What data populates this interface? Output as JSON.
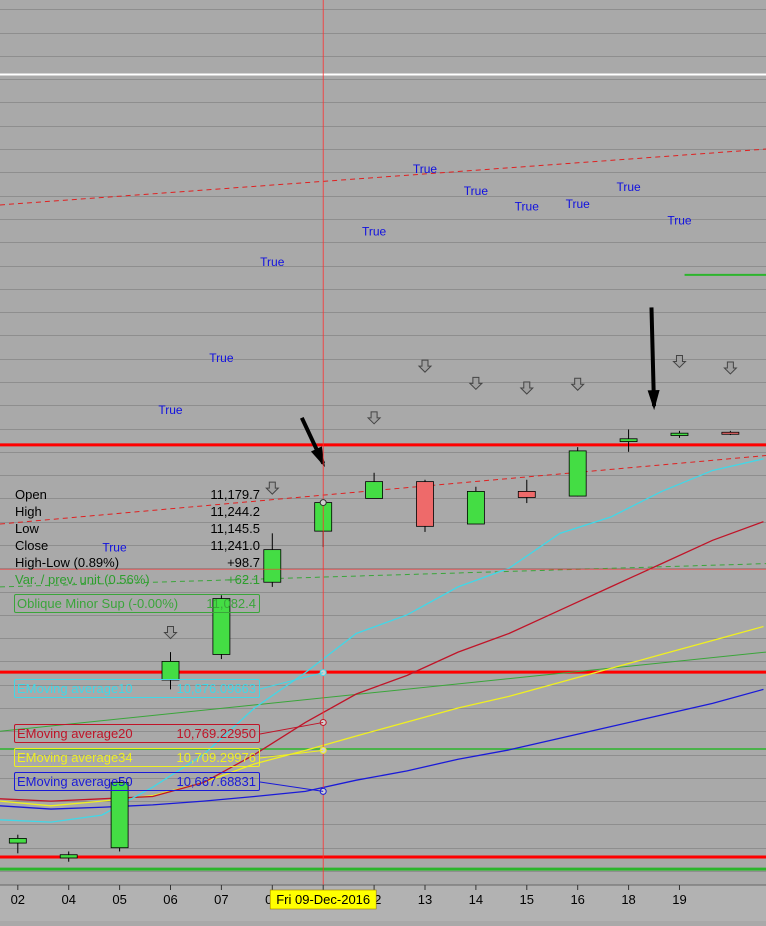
{
  "chart_data": {
    "type": "candlestick",
    "x_labels": [
      "02",
      "04",
      "05",
      "06",
      "07",
      "08",
      "09",
      "12",
      "13",
      "14",
      "15",
      "16",
      "18",
      "19"
    ],
    "cursor_date": "Fri 09-Dec-2016",
    "candles": [
      {
        "date": "02",
        "open": 10510,
        "high": 10528,
        "low": 10488,
        "close": 10520
      },
      {
        "date": "04",
        "open": 10478,
        "high": 10492,
        "low": 10470,
        "close": 10485
      },
      {
        "date": "05",
        "open": 10500,
        "high": 10650,
        "low": 10492,
        "close": 10640
      },
      {
        "date": "06",
        "open": 10860,
        "high": 10920,
        "low": 10840,
        "close": 10900
      },
      {
        "date": "07",
        "open": 10915,
        "high": 11042,
        "low": 10905,
        "close": 11035
      },
      {
        "date": "08",
        "open": 11070,
        "high": 11175,
        "low": 11060,
        "close": 11140
      },
      {
        "date": "09",
        "open": 11179.7,
        "high": 11244.2,
        "low": 11145.5,
        "close": 11241.0
      },
      {
        "date": "12",
        "open": 11250,
        "high": 11305,
        "low": 11250,
        "close": 11286
      },
      {
        "date": "13",
        "open": 11286,
        "high": 11290,
        "low": 11178,
        "close": 11190
      },
      {
        "date": "14",
        "open": 11195,
        "high": 11275,
        "low": 11195,
        "close": 11265
      },
      {
        "date": "15",
        "open": 11265,
        "high": 11290,
        "low": 11240,
        "close": 11252
      },
      {
        "date": "16",
        "open": 11255,
        "high": 11360,
        "low": 11254,
        "close": 11352
      },
      {
        "date": "18",
        "open": 11372,
        "high": 11398,
        "low": 11350,
        "close": 11378
      },
      {
        "date": "19",
        "open": 11385,
        "high": 11395,
        "low": 11380,
        "close": 11390
      },
      {
        "date": "20",
        "open": 11392,
        "high": 11395,
        "low": 11386,
        "close": 11389
      }
    ],
    "ema10": [
      10560,
      10555,
      10570,
      10630,
      10700,
      10800,
      10876,
      10960,
      11000,
      11060,
      11100,
      11175,
      11210,
      11265,
      11310,
      11335
    ],
    "ema20": [
      10605,
      10600,
      10605,
      10610,
      10640,
      10700,
      10769,
      10830,
      10870,
      10920,
      10960,
      11010,
      11060,
      11110,
      11160,
      11200
    ],
    "ema34": [
      10600,
      10590,
      10600,
      10612,
      10640,
      10680,
      10709,
      10740,
      10770,
      10800,
      10825,
      10855,
      10885,
      10915,
      10945,
      10975
    ],
    "ema50": [
      10590,
      10583,
      10587,
      10592,
      10600,
      10610,
      10621,
      10645,
      10665,
      10690,
      10710,
      10735,
      10760,
      10785,
      10810,
      10840
    ],
    "oblique_minor_sup": {
      "start_x": -0.35,
      "start_y": 11060,
      "end_x": 14.7,
      "end_y": 11110
    },
    "dashed_resistance": {
      "start_x": -0.35,
      "start_y": 11195,
      "end_x": 14.7,
      "end_y": 11342
    },
    "upper_dashed": {
      "start_x": -0.35,
      "start_y": 11880,
      "end_x": 14.7,
      "end_y": 12000
    },
    "horizontal_levels": [
      11365,
      10877,
      10480
    ],
    "green_levels": [
      10712,
      10454
    ],
    "short_green_level": {
      "y": 11730,
      "from_x": 13.1
    },
    "white_level": 12160,
    "true_markers": [
      {
        "x": 3,
        "y": 11431
      },
      {
        "x": 4,
        "y": 11543
      },
      {
        "x": 5,
        "y": 11749
      },
      {
        "x": 7,
        "y": 11814
      },
      {
        "x": 8,
        "y": 11949
      },
      {
        "x": 9,
        "y": 11901
      },
      {
        "x": 10,
        "y": 11868
      },
      {
        "x": 11,
        "y": 11873
      },
      {
        "x": 12,
        "y": 11910
      },
      {
        "x": 13,
        "y": 11838
      },
      {
        "x": 1.9,
        "y": 11136
      }
    ],
    "true_label": "True",
    "down_arrows": [
      {
        "x": 3,
        "y": 10962
      },
      {
        "x": 5,
        "y": 11272
      },
      {
        "x": 7,
        "y": 11423
      },
      {
        "x": 8,
        "y": 11534
      },
      {
        "x": 9,
        "y": 11497
      },
      {
        "x": 10,
        "y": 11487
      },
      {
        "x": 11,
        "y": 11495
      },
      {
        "x": 13,
        "y": 11544
      },
      {
        "x": 14,
        "y": 11530
      }
    ],
    "black_arrows": [
      {
        "x1": 5.58,
        "y1": 11423,
        "x2": 6,
        "y2": 11325
      },
      {
        "x1": 12.45,
        "y1": 11660,
        "x2": 12.5,
        "y2": 11448
      }
    ],
    "ylim": [
      10420,
      12320
    ],
    "xlim": [
      -0.35,
      14.7
    ],
    "grid": true
  },
  "info": {
    "rows": [
      {
        "label": "Open",
        "value": "11,179.7"
      },
      {
        "label": "High",
        "value": "11,244.2"
      },
      {
        "label": "Low",
        "value": "11,145.5"
      },
      {
        "label": "Close",
        "value": "11,241.0"
      },
      {
        "label": "High-Low (0.89%)",
        "value": "+98.7"
      },
      {
        "label": "Var. / prev. unit (0.56%)",
        "value": "+62.1"
      }
    ]
  },
  "indicators": [
    {
      "label": "Oblique Minor Sup (-0.00%)",
      "value": "11,082.4",
      "color": "#3aa53a"
    },
    {
      "label": "EMoving average10",
      "value": "10,876.09663",
      "color": "#40d8e8"
    },
    {
      "label": "EMoving average20",
      "value": "10,769.22950",
      "color": "#c01428"
    },
    {
      "label": "EMoving average34",
      "value": "10,709.29976",
      "color": "#f0f020"
    },
    {
      "label": "EMoving average50",
      "value": "10,667.68831",
      "color": "#1a1ad8"
    }
  ],
  "colors": {
    "background": "#a9a9a9",
    "up_candle": "#44dd44",
    "down_candle": "#ee6a6a",
    "level_red": "#ff0000",
    "level_green": "#2cb52c",
    "true_text": "#1010e0",
    "cursor_label_bg": "#ffff00"
  }
}
